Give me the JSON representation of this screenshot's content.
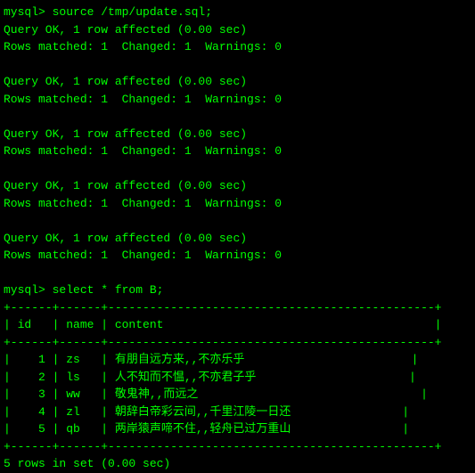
{
  "prompt1": "mysql> source /tmp/update.sql;",
  "query_results": [
    {
      "ok_line": "Query OK, 1 row affected (0.00 sec)",
      "matched_line": "Rows matched: 1  Changed: 1  Warnings: 0"
    },
    {
      "ok_line": "Query OK, 1 row affected (0.00 sec)",
      "matched_line": "Rows matched: 1  Changed: 1  Warnings: 0"
    },
    {
      "ok_line": "Query OK, 1 row affected (0.00 sec)",
      "matched_line": "Rows matched: 1  Changed: 1  Warnings: 0"
    },
    {
      "ok_line": "Query OK, 1 row affected (0.00 sec)",
      "matched_line": "Rows matched: 1  Changed: 1  Warnings: 0"
    },
    {
      "ok_line": "Query OK, 1 row affected (0.00 sec)",
      "matched_line": "Rows matched: 1  Changed: 1  Warnings: 0"
    }
  ],
  "prompt2": "mysql> select * from B;",
  "table_border": "+------+------+-----------------------------------------------+",
  "table_header": "| id   | name | content                                       |",
  "table_rows": [
    "|    1 | zs   | 有朋自远方来,,不亦乐乎                        |",
    "|    2 | ls   | 人不知而不愠,,不亦君子乎                      |",
    "|    3 | ww   | 敬鬼神,,而远之                                |",
    "|    4 | zl   | 朝辞白帝彩云间,,千里江陵一日还                |",
    "|    5 | qb   | 两岸猿声啼不住,,轻舟已过万重山                |"
  ],
  "footer": "5 rows in set (0.00 sec)"
}
